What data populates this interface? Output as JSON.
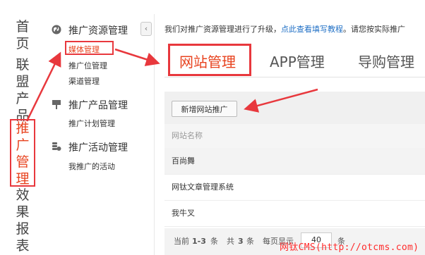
{
  "leftnav": {
    "items": [
      {
        "label": "首页"
      },
      {
        "label": "联盟产品"
      },
      {
        "label": "推广管理"
      },
      {
        "label": "效果报表"
      }
    ]
  },
  "sidebar": {
    "collapse_glyph": "‹",
    "groups": [
      {
        "title": "推广资源管理",
        "icon": "globe-icon",
        "items": [
          {
            "label": "媒体管理"
          },
          {
            "label": "推广位管理"
          },
          {
            "label": "渠道管理"
          }
        ]
      },
      {
        "title": "推广产品管理",
        "icon": "pin-icon",
        "items": [
          {
            "label": "推广计划管理"
          }
        ]
      },
      {
        "title": "推广活动管理",
        "icon": "coins-icon",
        "items": [
          {
            "label": "我推广的活动"
          }
        ]
      }
    ]
  },
  "notice": {
    "text": "我们对推广资源管理进行了升级，",
    "link": "点此查看填写教程",
    "tail": "。请您按实际推广"
  },
  "tabs": [
    {
      "label": "网站管理",
      "active": true
    },
    {
      "label": "APP管理"
    },
    {
      "label": "导购管理"
    }
  ],
  "toolbar": {
    "add_label": "新增网站推广"
  },
  "table": {
    "column": "网站名称",
    "rows": [
      "百尚舞",
      "网钛文章管理系统",
      "我牛叉"
    ]
  },
  "pager": {
    "current_prefix": "当前",
    "range": "1-3",
    "unit": "条",
    "total_prefix": "共",
    "total": "3",
    "total_unit": "条",
    "perpage_label": "每页显示",
    "perpage_value": "40",
    "perpage_unit": "条"
  },
  "watermark": "网钛CMS(http://otcms.com)",
  "colors": {
    "accent": "#e8431f",
    "annotation": "#e8383d",
    "link": "#1f6fc5"
  }
}
